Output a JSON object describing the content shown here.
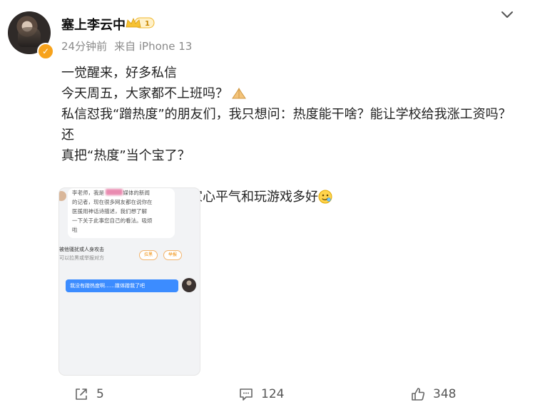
{
  "post": {
    "username": "塞上李云中",
    "badge_level": "1",
    "time": "24分钟前",
    "source": "来自 iPhone 13",
    "lines": [
      "一觉醒来，好多私信",
      "今天周五，大家都不上班吗？",
      "私信怼我“蹭热度”的朋友们，我只想问：热度能干啥？能让学校给我涨工资吗？还",
      "真把“热度”当个宝了？",
      "截图表明我的立场，大家心平气和玩游戏多好"
    ]
  },
  "screenshot": {
    "bubble_lines": [
      "李老师，我是",
      "的记者，现在很多网友都在说你在",
      "医援用神话诗描述，我们想了解",
      "一下关于此事您自己的看法。吸烦",
      "啦"
    ],
    "bubble_line1_tail": "媒体的新闻",
    "notice_title": "被他骚扰或人身攻击",
    "notice_sub": "可以拉黑或举报对方",
    "notice_btn1": "拉黑",
    "notice_btn2": "举报",
    "reply": "我没有蹭热度啊……媒体蹭我了吧"
  },
  "actions": {
    "share_count": "5",
    "comment_count": "124",
    "like_count": "348"
  },
  "colors": {
    "accent_blue": "#3c8cff",
    "verified_orange": "#f7a21b",
    "meta_gray": "#8a8a8a"
  },
  "icons": {
    "share": "share-icon",
    "comment": "comment-icon",
    "like": "thumbs-up-icon",
    "more": "chevron-down-icon"
  }
}
